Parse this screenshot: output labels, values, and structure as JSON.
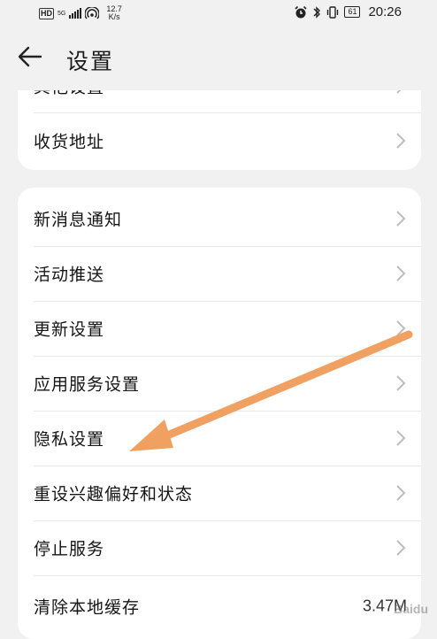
{
  "status_bar": {
    "hd": "HD",
    "network": "5G",
    "speed_value": "12.7",
    "speed_unit": "K/s",
    "battery": "61",
    "time": "20:26"
  },
  "header": {
    "title": "设置"
  },
  "top_card": {
    "partial_item": "其他设置",
    "items": [
      {
        "label": "收货地址"
      }
    ]
  },
  "main_card": {
    "items": [
      {
        "label": "新消息通知"
      },
      {
        "label": "活动推送"
      },
      {
        "label": "更新设置"
      },
      {
        "label": "应用服务设置"
      },
      {
        "label": "隐私设置"
      },
      {
        "label": "重设兴趣偏好和状态"
      },
      {
        "label": "停止服务"
      },
      {
        "label": "清除本地缓存",
        "value": "3.47M"
      }
    ]
  },
  "annotation": {
    "color": "#f0a060",
    "points_to": "隐私设置"
  },
  "watermark": "Baidu"
}
